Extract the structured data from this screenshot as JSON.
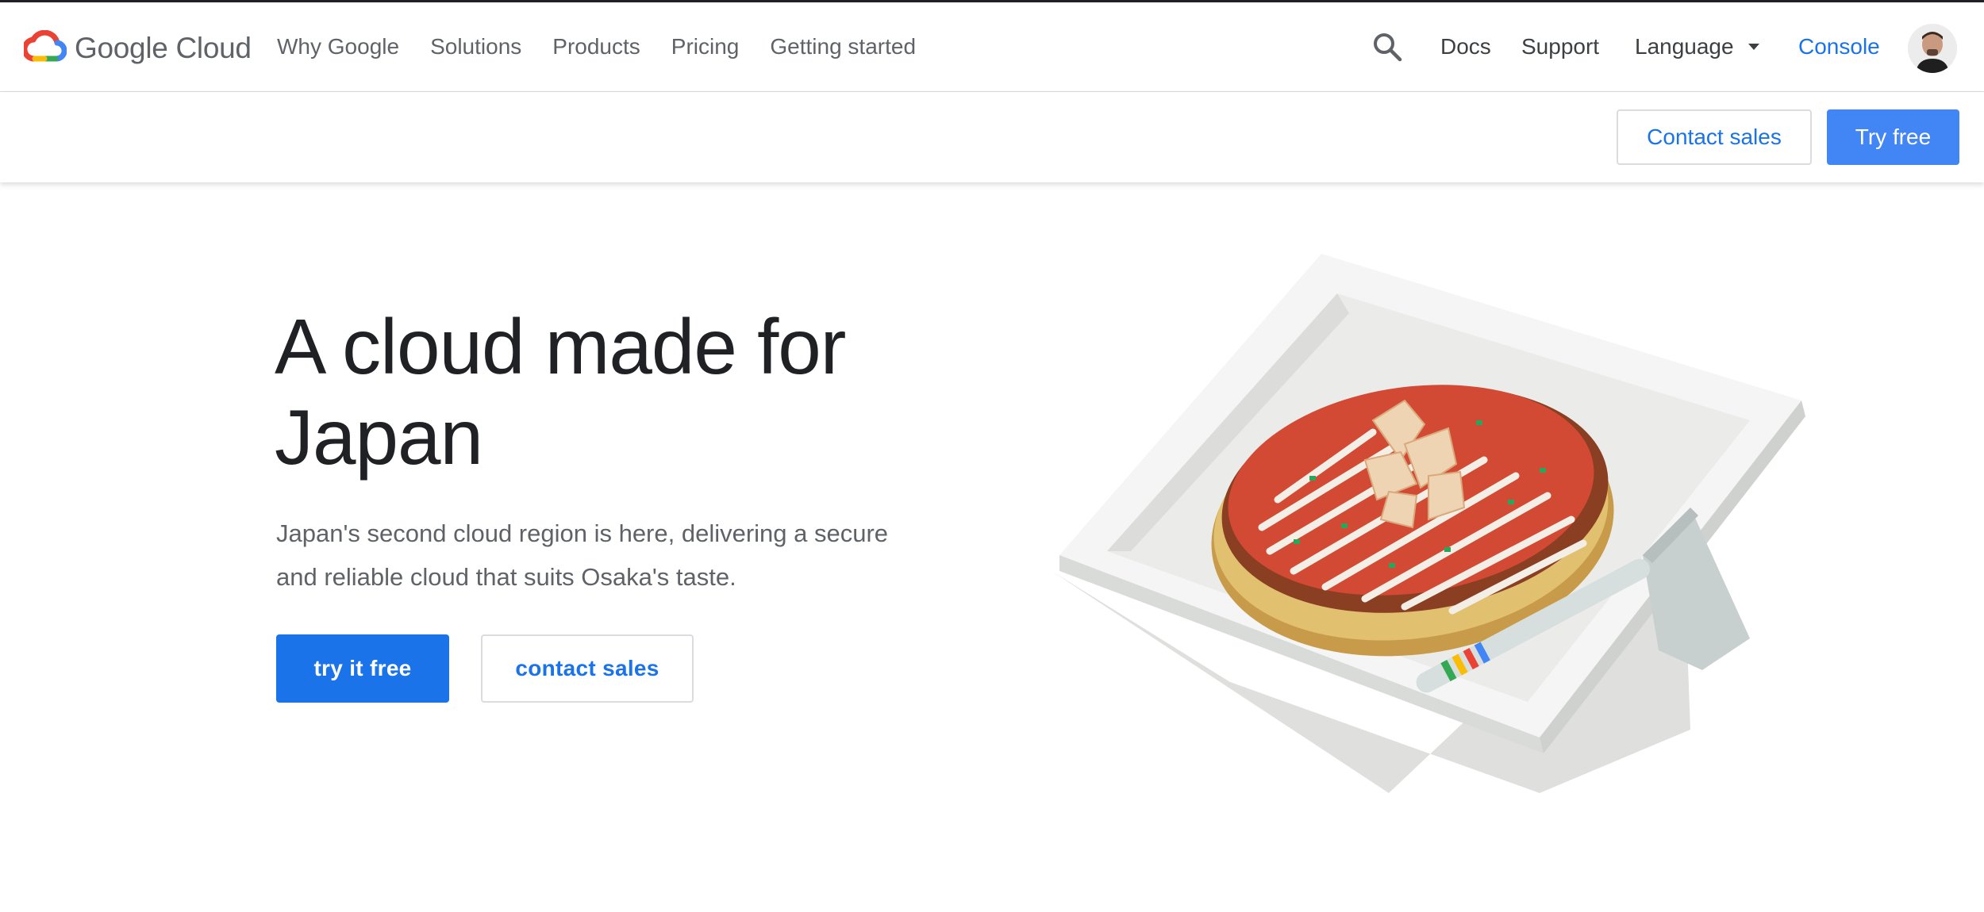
{
  "header": {
    "logo_text": "Google Cloud",
    "nav": [
      "Why Google",
      "Solutions",
      "Products",
      "Pricing",
      "Getting started"
    ],
    "docs": "Docs",
    "support": "Support",
    "language": "Language",
    "console": "Console"
  },
  "subbar": {
    "contact_sales": "Contact sales",
    "try_free": "Try free"
  },
  "hero": {
    "title_line1": "A cloud made for",
    "title_line2": "Japan",
    "subtitle_line1": "Japan's second cloud region is here, delivering a secure",
    "subtitle_line2": "and reliable cloud that suits Osaka's taste.",
    "primary_cta": "try it free",
    "secondary_cta": "contact sales"
  },
  "colors": {
    "accent": "#1a73e8",
    "try_free_bg": "#4285f4",
    "text_primary": "#202124",
    "text_secondary": "#5f6368"
  },
  "icons": {
    "logo": "google-cloud-logo-icon",
    "search": "search-icon",
    "language_caret": "caret-down-icon",
    "avatar": "user-avatar"
  }
}
